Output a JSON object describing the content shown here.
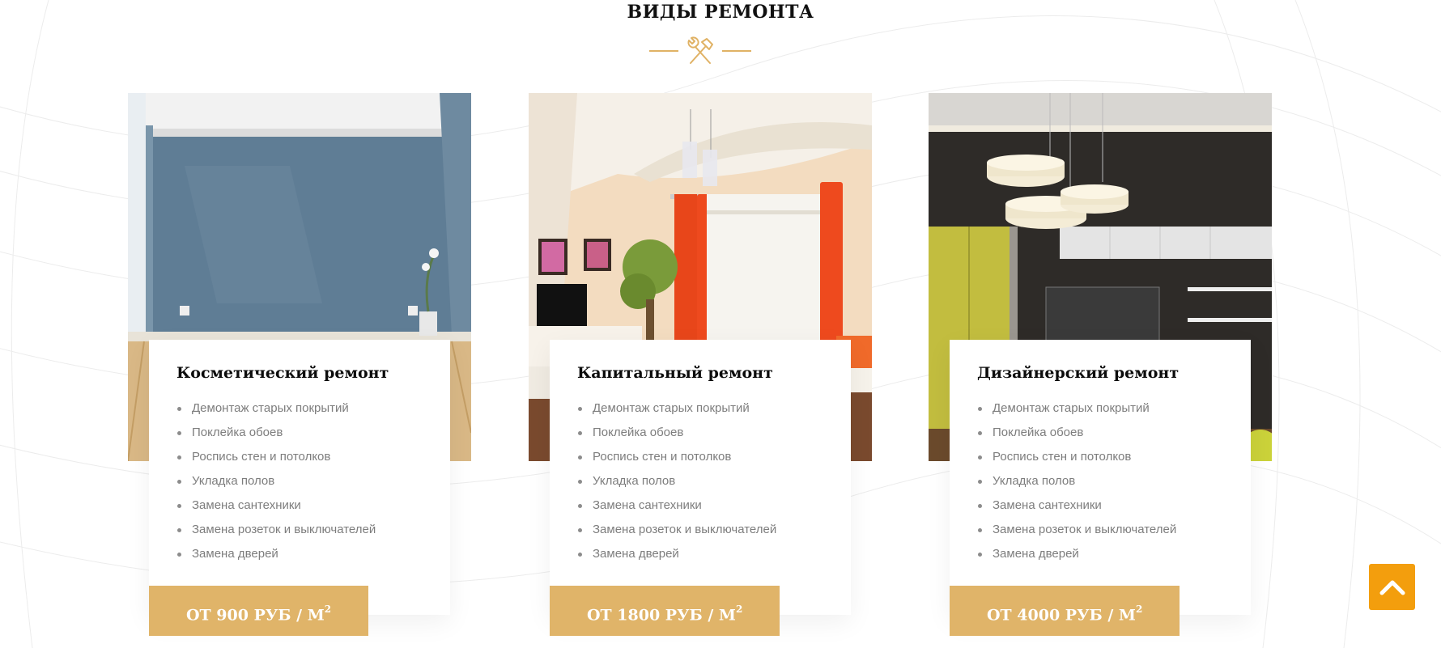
{
  "section": {
    "title": "ВИДЫ РЕМОНТА"
  },
  "icons": {
    "divider": "hammer-wrench-icon",
    "scroll_top": "chevron-up-icon"
  },
  "colors": {
    "accent": "#e0b469",
    "scroll_top": "#f39e0d",
    "title": "#111111",
    "list_text": "#7d7d7d"
  },
  "cards": [
    {
      "title": "Косметический ремонт",
      "items": [
        "Демонтаж старых покрытий",
        "Поклейка обоев",
        "Роспись стен и потолков",
        "Укладка полов",
        "Замена сантехники",
        "Замена розеток и выключателей",
        "Замена дверей"
      ],
      "price": "ОТ 900 РУБ / М",
      "price_sup": "2"
    },
    {
      "title": "Капитальный ремонт",
      "items": [
        "Демонтаж старых покрытий",
        "Поклейка обоев",
        "Роспись стен и потолков",
        "Укладка полов",
        "Замена сантехники",
        "Замена розеток и выключателей",
        "Замена дверей"
      ],
      "price": "ОТ 1800 РУБ / М",
      "price_sup": "2"
    },
    {
      "title": "Дизайнерский ремонт",
      "items": [
        "Демонтаж старых покрытий",
        "Поклейка обоев",
        "Роспись стен и потолков",
        "Укладка полов",
        "Замена сантехники",
        "Замена розеток и выключателей",
        "Замена дверей"
      ],
      "price": "ОТ 4000 РУБ / М",
      "price_sup": "2"
    }
  ]
}
